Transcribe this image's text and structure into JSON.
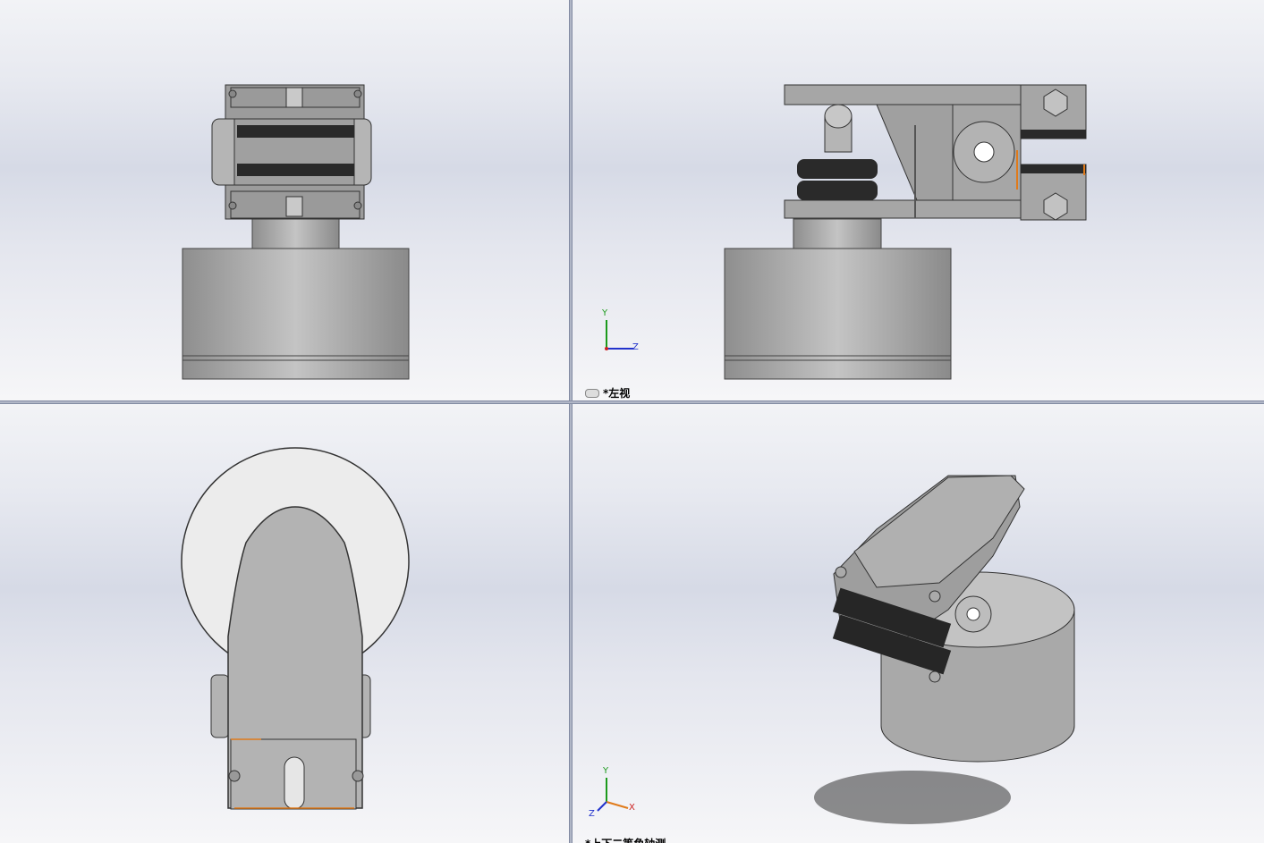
{
  "viewports": {
    "top_left": {
      "label": ""
    },
    "top_right": {
      "label": "*左视"
    },
    "bottom_left": {
      "label": ""
    },
    "bottom_right": {
      "label": "*上下二等角轴测"
    }
  },
  "triad": {
    "left_view": {
      "y": "Y",
      "z": "Z"
    },
    "iso_view": {
      "y": "Y",
      "z": "Z",
      "x": "X"
    }
  },
  "colors": {
    "part_gray": "#a8a8a8",
    "rubber": "#2a2a2a",
    "edge": "#3a3a3a",
    "highlight_orange": "#e07a1a",
    "axis_y": "#1c9a1c",
    "axis_z": "#2233cc",
    "axis_x": "#cc2222"
  }
}
